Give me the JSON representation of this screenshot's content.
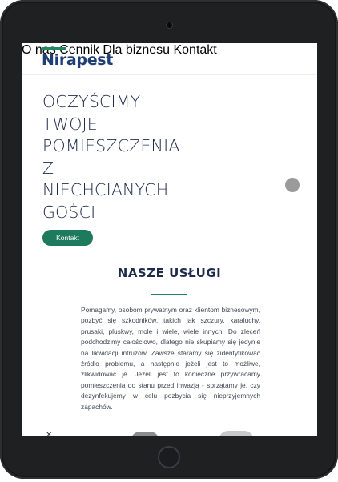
{
  "brand": {
    "name": "Nirapest",
    "accent": "#1e8a5e",
    "logo_color": "#1f3f74"
  },
  "nav": [
    {
      "label": "O nas"
    },
    {
      "label": "Cennik"
    },
    {
      "label": "Dla biznesu"
    },
    {
      "label": "Kontakt"
    }
  ],
  "hero": {
    "title_lines": [
      "OCZYŚCIMY",
      "TWOJE",
      "POMIESZCZENIA",
      "Z",
      "NIECHCIANYCH",
      "GOŚCI"
    ],
    "cta_label": "Kontakt",
    "cta_color": "#1e7a5c"
  },
  "services": {
    "title": "NASZE USŁUGI",
    "description": "Pomagamy, osobom prywatnym oraz klientom biznesowym, pozbyć się szkodników, takich jak szczury, karaluchy, prusaki, pluskwy, mole i wiele, wiele innych. Do zleceń podchodzimy całościowo, dlatego nie skupiamy się jedynie na likwidacji intruzów. Zawsze staramy się zidentyfikować źródło problemu, a następnie jeżeli jest to możliwe, zlikwidować je. Jeżeli jest to konieczne przywracamy pomieszczenia do stanu przed inwazją - sprzątamy je, czy dezynfekujemy w celu pozbycia się nieprzyjemnych zapachów."
  },
  "icons": [
    "camera-icon",
    "home-button-icon",
    "scroll-indicator-icon",
    "close-icon"
  ]
}
